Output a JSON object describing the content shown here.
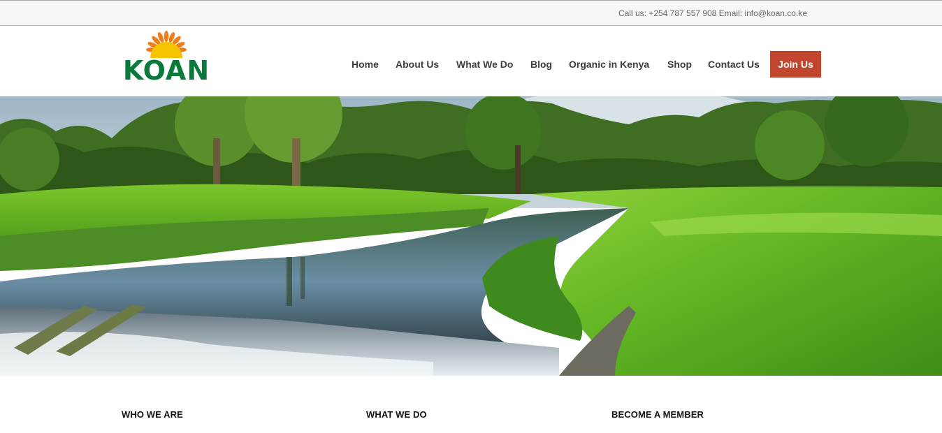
{
  "topbar": {
    "contact_text": "Call us: +254 787 557 908 Email: info@koan.co.ke"
  },
  "brand": {
    "logo_text": "KOAN",
    "logo_colors": {
      "text": "#0a7a3c",
      "sun": "#f5c400",
      "rays": "#f07d1a"
    }
  },
  "nav": {
    "items": [
      {
        "label": "Home"
      },
      {
        "label": "About Us"
      },
      {
        "label": "What We Do"
      },
      {
        "label": "Blog"
      },
      {
        "label": "Organic in Kenya"
      },
      {
        "label": "Shop"
      },
      {
        "label": "Contact Us"
      }
    ],
    "cta": {
      "label": "Join Us",
      "color": "#c2452d"
    }
  },
  "hero": {
    "image": "golf-course-river-landscape"
  },
  "sections": {
    "items": [
      {
        "title": "WHO WE ARE"
      },
      {
        "title": "WHAT WE DO"
      },
      {
        "title": "BECOME A MEMBER"
      }
    ]
  }
}
